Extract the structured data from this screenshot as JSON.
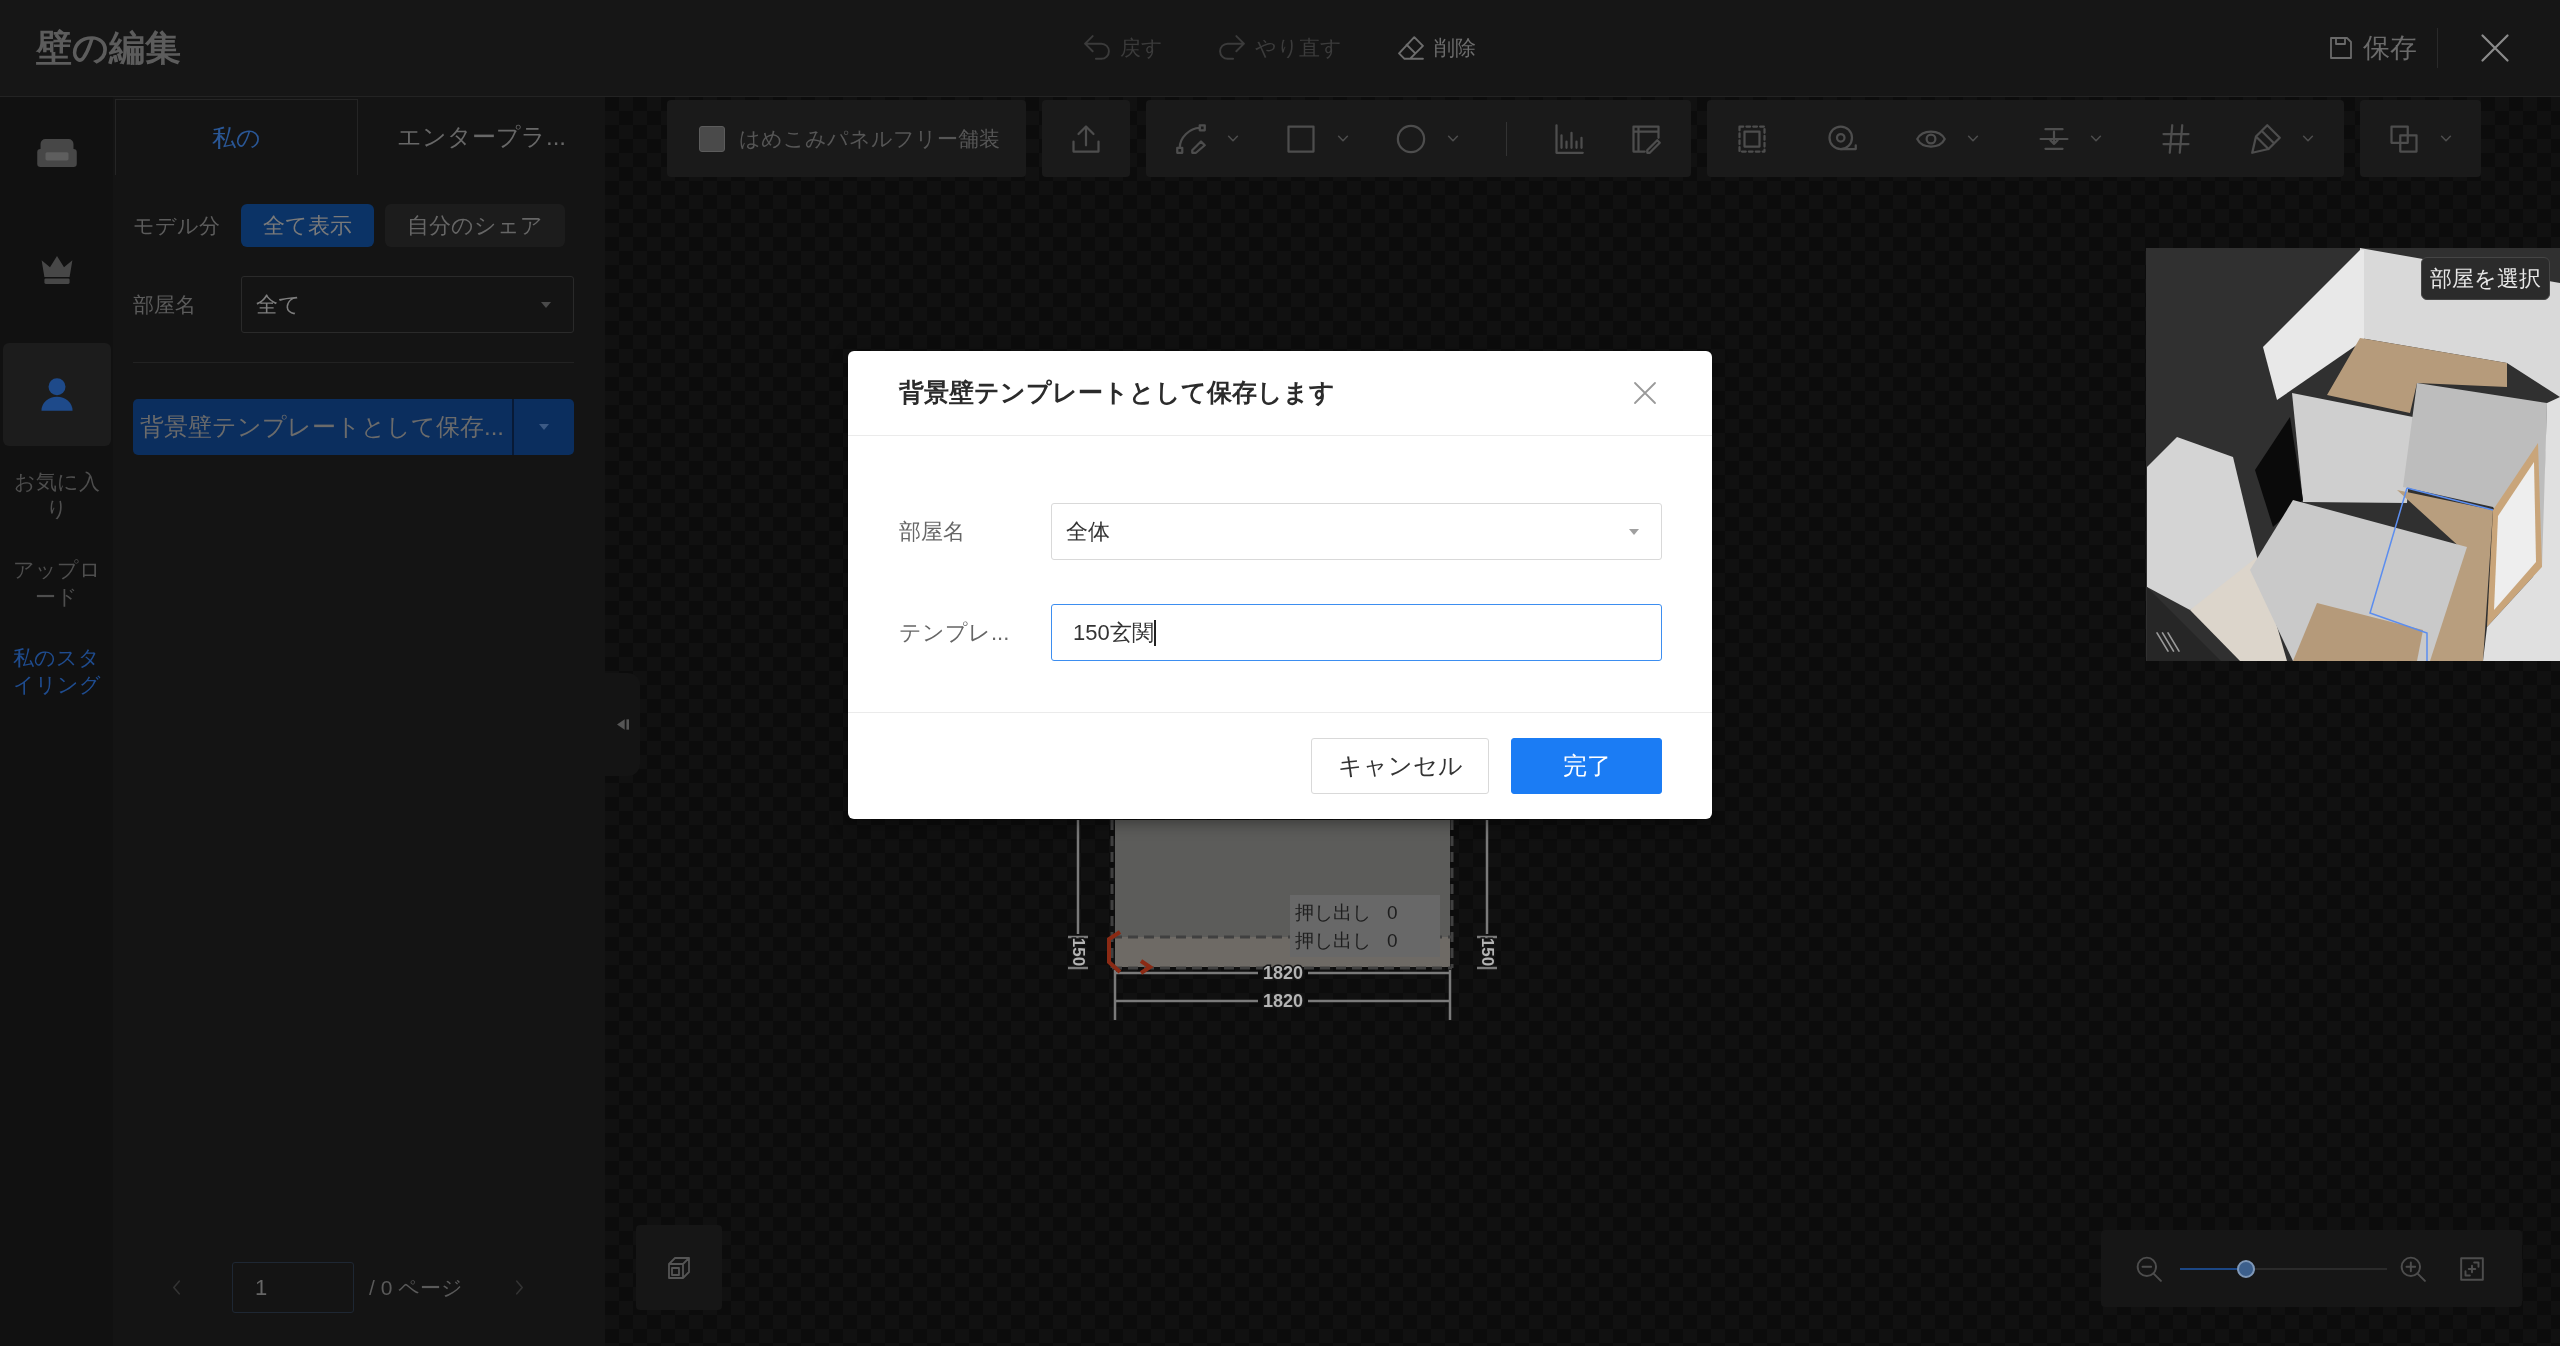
{
  "window": {
    "title": "壁の編集"
  },
  "history_actions": [
    {
      "kind": "undo",
      "label": "戻す",
      "disabled": true
    },
    {
      "kind": "redo",
      "label": "やり直す",
      "disabled": true
    },
    {
      "kind": "erase",
      "label": "削除",
      "disabled": false
    }
  ],
  "header": {
    "save_label": "保存"
  },
  "rail": {
    "icon_items": [
      {
        "kind": "sofa",
        "selected": false
      },
      {
        "kind": "crown",
        "selected": false
      },
      {
        "kind": "person",
        "selected": true
      }
    ],
    "text_items": [
      {
        "label": "お気に入り",
        "selected": false
      },
      {
        "label": "アップロード",
        "selected": false
      },
      {
        "label": "私のスタイリング",
        "selected": true
      }
    ]
  },
  "panel": {
    "tabs": [
      {
        "label": "私の",
        "selected": true
      },
      {
        "label": "エンタープラ...",
        "selected": false
      }
    ],
    "filter": {
      "label": "モデル分",
      "options": [
        {
          "label": "全て表示",
          "selected": true
        },
        {
          "label": "自分のシェア",
          "selected": false
        }
      ]
    },
    "room": {
      "label": "部屋名",
      "value": "全て"
    },
    "save_button": "背景壁テンプレートとして保存...",
    "pagination": {
      "page": "1",
      "total": "/ 0 ページ"
    }
  },
  "toolbar": {
    "checkbox": {
      "label": "はめこみパネルフリー舗装",
      "checked": false
    },
    "groups": [
      [
        {
          "kind": "upload",
          "dropdown": false
        }
      ],
      [
        {
          "kind": "pen",
          "dropdown": true
        },
        {
          "kind": "rect",
          "dropdown": true
        },
        {
          "kind": "ellipse",
          "dropdown": true
        },
        {
          "kind": "divider"
        },
        {
          "kind": "dimension",
          "dropdown": false
        },
        {
          "kind": "sheet",
          "dropdown": false
        }
      ],
      [
        {
          "kind": "frame",
          "dropdown": false
        },
        {
          "kind": "tape",
          "dropdown": false
        },
        {
          "kind": "eye",
          "dropdown": true
        },
        {
          "kind": "align",
          "dropdown": true
        },
        {
          "kind": "grid",
          "dropdown": false
        },
        {
          "kind": "brush",
          "dropdown": true
        }
      ],
      [
        {
          "kind": "copy",
          "dropdown": true
        }
      ]
    ]
  },
  "canvas": {
    "side_dimensions": [
      "150",
      "150"
    ],
    "width_dimensions": [
      "1820",
      "1820"
    ],
    "extrusions": [
      {
        "label": "押し出し",
        "value": "0"
      },
      {
        "label": "押し出し",
        "value": "0"
      }
    ]
  },
  "preview": {
    "label": "部屋を選択"
  },
  "zoom": {
    "level": 0.32
  },
  "dialog": {
    "title": "背景壁テンプレートとして保存します",
    "fields": [
      {
        "kind": "select",
        "label": "部屋名",
        "value": "全体",
        "focused": false
      },
      {
        "kind": "text",
        "label": "テンプレ...",
        "value": "150玄関",
        "focused": true
      }
    ],
    "buttons": [
      {
        "label": "キャンセル",
        "primary": false
      },
      {
        "label": "完了",
        "primary": true
      }
    ]
  }
}
